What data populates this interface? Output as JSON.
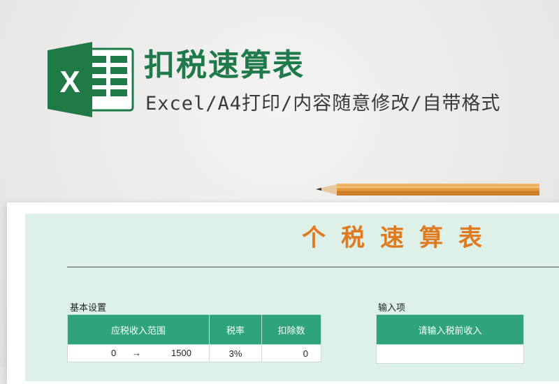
{
  "header": {
    "title": "扣税速算表",
    "subtitle": "Excel/A4打印/内容随意修改/自带格式",
    "logo_icon": "excel-logo-icon",
    "logo_letter": "X",
    "brand_color": "#1e7a48"
  },
  "decoration": {
    "pencil_icon": "pencil-icon"
  },
  "sheet": {
    "title": "个税速算表",
    "title_color": "#e07a1f",
    "background_color": "#ddf1e9",
    "basic_settings": {
      "label": "基本设置",
      "columns": [
        "应税收入范围",
        "税率",
        "扣除数"
      ],
      "rows": [
        {
          "from": "0",
          "arrow": "→",
          "to": "1500",
          "rate": "3%",
          "deduction": "0"
        }
      ]
    },
    "input": {
      "label": "输入项",
      "column": "请输入税前收入"
    },
    "header_color": "#2ea37c"
  }
}
